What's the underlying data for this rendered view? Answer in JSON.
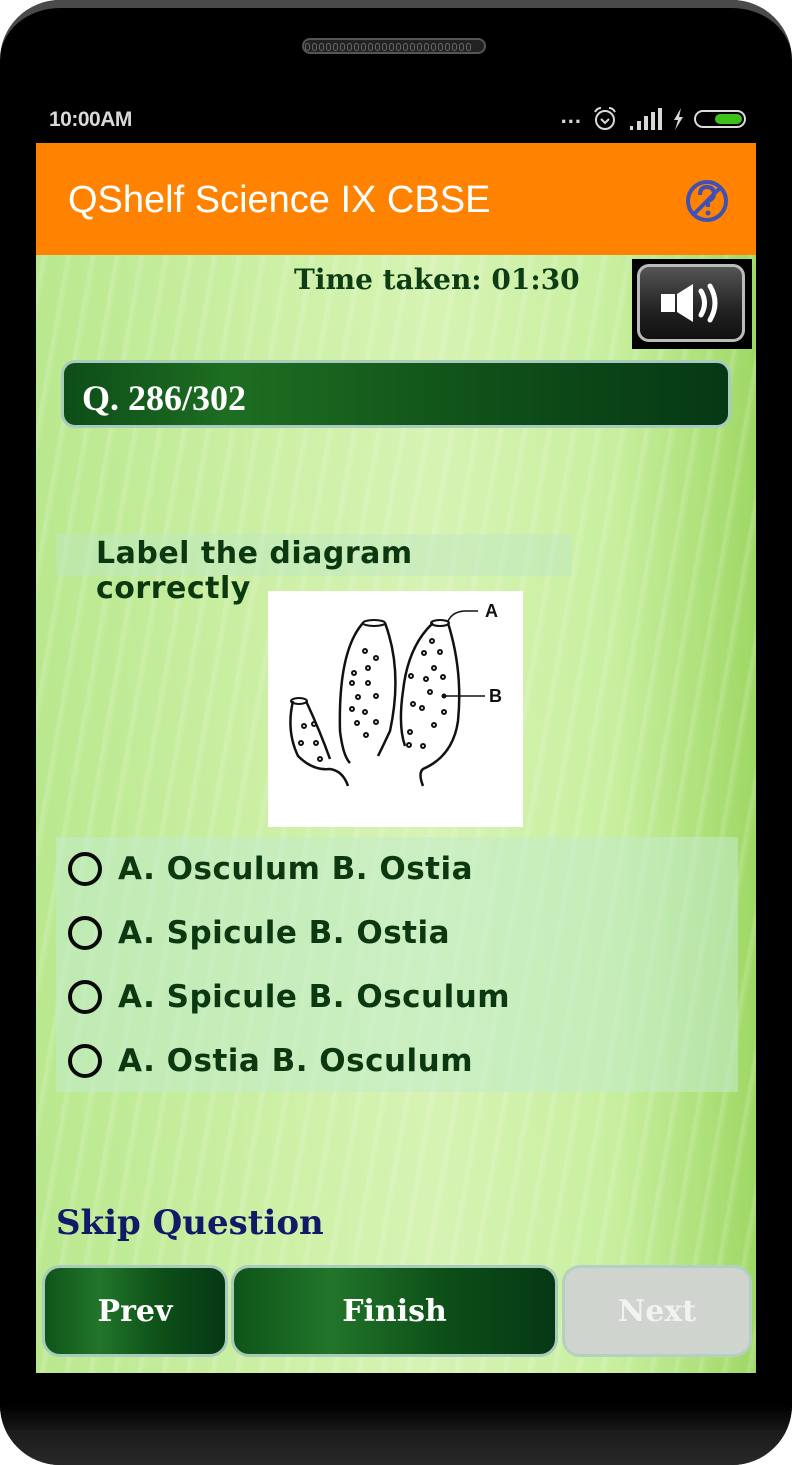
{
  "status_bar": {
    "time": "10:00AM",
    "icons": [
      "more-dots-icon",
      "alarm-icon",
      "signal-icon",
      "charging-icon",
      "battery-icon"
    ],
    "more": "...",
    "battery_color": "#3fbf1a"
  },
  "app_bar": {
    "title": "QShelf Science IX CBSE",
    "background_color": "#ff8300",
    "help_icon": "no-help-icon",
    "help_icon_color": "#3f51b5"
  },
  "quiz": {
    "timer_label": "Time taken: 01:30",
    "sound_icon": "speaker-icon",
    "question_number": "Q. 286/302",
    "question_text": "Label the diagram correctly",
    "diagram": {
      "description": "Sponge diagram",
      "labels": [
        "A",
        "B"
      ]
    },
    "options": [
      {
        "label": "A. Osculum B. Ostia",
        "selected": false
      },
      {
        "label": "A. Spicule B. Ostia",
        "selected": false
      },
      {
        "label": "A. Spicule B. Osculum",
        "selected": false
      },
      {
        "label": "A. Ostia B. Osculum",
        "selected": false
      }
    ],
    "skip_label": "Skip Question"
  },
  "navigation": {
    "prev_label": "Prev",
    "finish_label": "Finish",
    "next_label": "Next",
    "next_enabled": false
  }
}
